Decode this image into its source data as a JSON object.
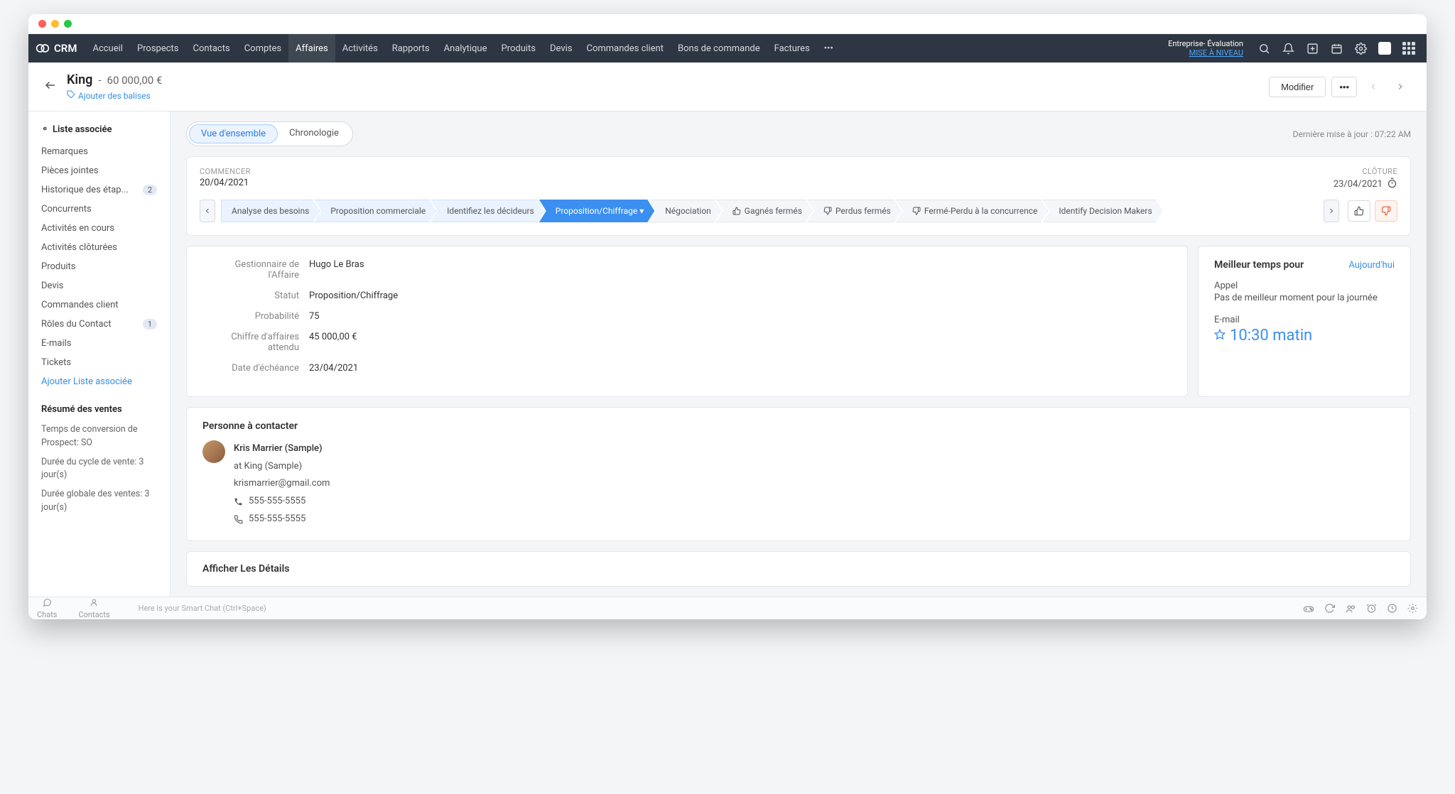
{
  "brand": "CRM",
  "nav": {
    "items": [
      "Accueil",
      "Prospects",
      "Contacts",
      "Comptes",
      "Affaires",
      "Activités",
      "Rapports",
      "Analytique",
      "Produits",
      "Devis",
      "Commandes client",
      "Bons de commande",
      "Factures"
    ],
    "active_index": 4,
    "enterprise_label": "Entreprise- Évaluation",
    "upgrade_label": "MISE À NIVEAU"
  },
  "record": {
    "name": "King",
    "amount_sep": " - ",
    "amount": "60 000,00 €",
    "add_tags": "Ajouter des balises",
    "modify_button": "Modifier"
  },
  "sidebar": {
    "list_title": "Liste associée",
    "items": [
      {
        "label": "Remarques"
      },
      {
        "label": "Pièces jointes"
      },
      {
        "label": "Historique des étap...",
        "badge": "2"
      },
      {
        "label": "Concurrents"
      },
      {
        "label": "Activités en cours"
      },
      {
        "label": "Activités clôturées"
      },
      {
        "label": "Produits"
      },
      {
        "label": "Devis"
      },
      {
        "label": "Commandes client"
      },
      {
        "label": "Rôles du Contact",
        "badge": "1"
      },
      {
        "label": "E-mails"
      },
      {
        "label": "Tickets"
      }
    ],
    "add_list": "Ajouter Liste associée",
    "summary_title": "Résumé des ventes",
    "metrics": [
      "Temps de conversion de Prospect: SO",
      "Durée du cycle de vente: 3 jour(s)",
      "Durée globale des ventes: 3 jour(s)"
    ]
  },
  "tabs": {
    "overview": "Vue d'ensemble",
    "timeline": "Chronologie",
    "last_updated": "Dernière mise à jour : 07:22 AM"
  },
  "stage": {
    "start_label": "COMMENCER",
    "start_date": "20/04/2021",
    "close_label": "CLÔTURE",
    "close_date": "23/04/2021",
    "segments": [
      {
        "label": "Analyse des besoins",
        "kind": "past"
      },
      {
        "label": "Proposition commerciale",
        "kind": "past"
      },
      {
        "label": "Identifiez les décideurs",
        "kind": "past"
      },
      {
        "label": "Proposition/Chiffrage",
        "kind": "active",
        "dropdown": true
      },
      {
        "label": "Négociation",
        "kind": "future"
      },
      {
        "label": "Gagnés fermés",
        "kind": "future",
        "icon": "up"
      },
      {
        "label": "Perdus fermés",
        "kind": "future",
        "icon": "down"
      },
      {
        "label": "Fermé-Perdu à la concurrence",
        "kind": "future",
        "icon": "down"
      },
      {
        "label": "Identify Decision Makers",
        "kind": "future"
      }
    ]
  },
  "details": {
    "rows": [
      {
        "label": "Gestionnaire de l'Affaire",
        "value": "Hugo Le Bras"
      },
      {
        "label": "Statut",
        "value": "Proposition/Chiffrage"
      },
      {
        "label": "Probabilité",
        "value": "75"
      },
      {
        "label": "Chiffre d'affaires attendu",
        "value": "45 000,00 €"
      },
      {
        "label": "Date d'échéance",
        "value": "23/04/2021"
      }
    ]
  },
  "besttime": {
    "title": "Meilleur temps pour",
    "today": "Aujourd'hui",
    "call_label": "Appel",
    "call_msg": "Pas de meilleur moment pour la journée",
    "email_label": "E-mail",
    "email_time": "10:30 matin"
  },
  "contact": {
    "section_title": "Personne à contacter",
    "name": "Kris Marrier (Sample)",
    "at": "at King (Sample)",
    "email": "krismarrier@gmail.com",
    "phone1": "555-555-5555",
    "phone2": "555-555-5555"
  },
  "show_details": "Afficher Les Détails",
  "bottombar": {
    "chats": "Chats",
    "contacts": "Contacts",
    "hint": "Here is your Smart Chat (Ctrl+Space)"
  }
}
